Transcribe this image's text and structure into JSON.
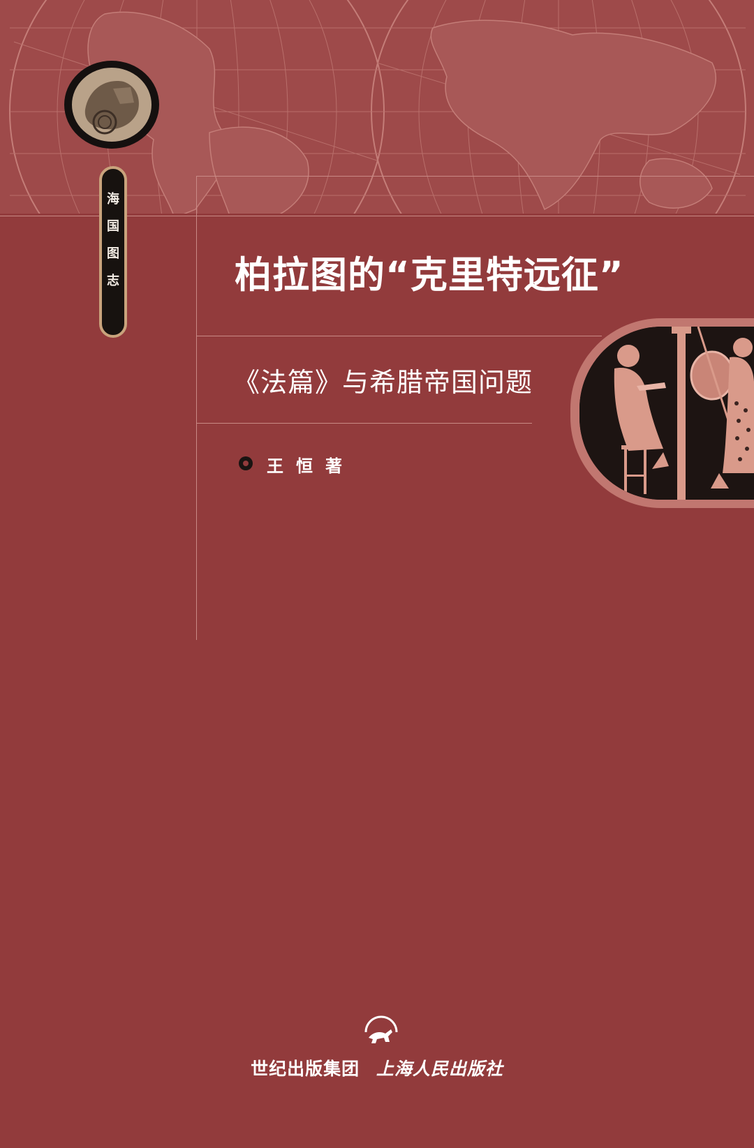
{
  "series": {
    "name_chars": [
      "海",
      "国",
      "图",
      "志"
    ]
  },
  "book": {
    "title": "柏拉图的“克里特远征”",
    "subtitle": "《法篇》与希腊帝国问题",
    "author": "王恒著"
  },
  "publisher": {
    "group": "世纪出版集团",
    "imprint": "上海人民出版社"
  },
  "colors": {
    "background": "#923b3c",
    "map_tint": "#b06562",
    "rules": "#c98a86",
    "vase_frame": "#c17770",
    "text": "#ffffff"
  },
  "icons": {
    "series_emblem": "engraved-medallion",
    "cover_artwork": "greek-red-figure-vase",
    "publisher_logo": "horse-emblem"
  }
}
